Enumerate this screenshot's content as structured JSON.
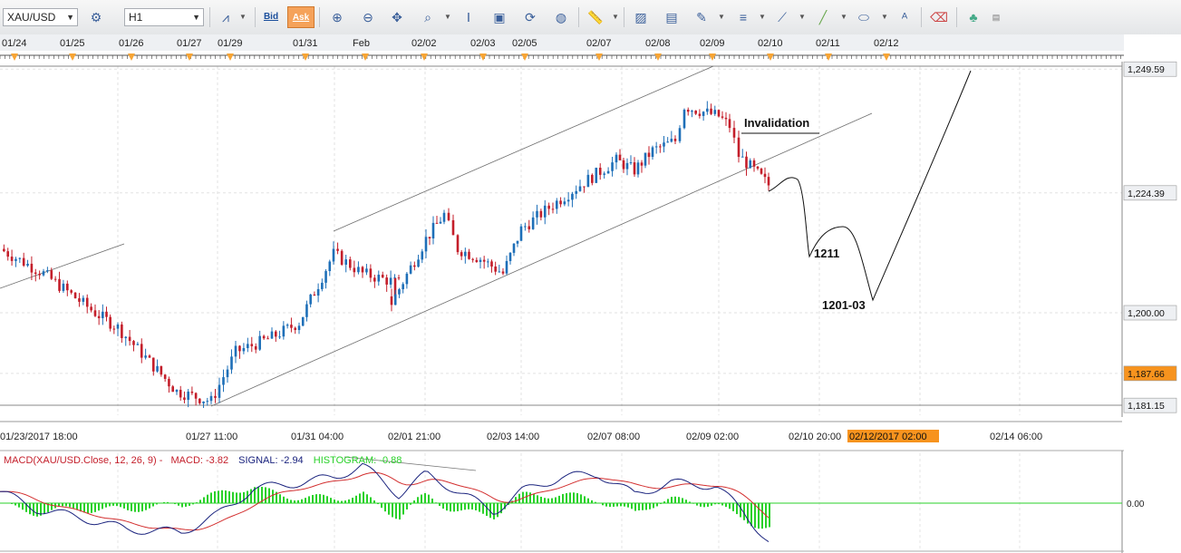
{
  "toolbar": {
    "symbol": "XAU/USD",
    "timeframe": "H1",
    "bid_label": "Bid",
    "ask_label": "Ask",
    "icons": [
      "line-chart-icon",
      "bid-icon",
      "ask-icon",
      "zoom-in-icon",
      "zoom-out-icon",
      "crosshair-icon",
      "indicator-icon",
      "grid-icon",
      "template-icon",
      "refresh-icon",
      "globe-icon",
      "ruler-icon",
      "image-icon",
      "screenshot-icon",
      "pencil-tools-icon",
      "lines-icon",
      "trend-line-icon",
      "draw-line-icon",
      "ellipse-icon",
      "text-icon",
      "eraser-icon",
      "objects-icon"
    ]
  },
  "top_dates": [
    "01/24",
    "01/25",
    "01/26",
    "01/27",
    "01/29",
    "01/31",
    "Feb",
    "02/02",
    "02/03",
    "02/05",
    "02/07",
    "02/08",
    "02/09",
    "02/10",
    "02/11",
    "02/12"
  ],
  "bottom_dates": [
    "01/23/2017 18:00",
    "01/27 11:00",
    "01/31 04:00",
    "02/01 21:00",
    "02/03 14:00",
    "02/07 08:00",
    "02/09 02:00",
    "02/10 20:00",
    "02/12/2017 02:00",
    "02/14 06:00"
  ],
  "highlighted_date": "02/12/2017 02:00",
  "price_labels": [
    "1,249.59",
    "1,224.39",
    "1,200.00",
    "1,187.66",
    "1,181.15"
  ],
  "current_price": "1,187.66",
  "annotations": {
    "invalidation": "Invalidation",
    "target1": "1211",
    "target2": "1201-03"
  },
  "macd_legend": {
    "name": "MACD(XAU/USD.Close, 12, 26, 9) -",
    "macd": "MACD: -3.82",
    "signal": "SIGNAL: -2.94",
    "histogram": "HISTOGRAM: -0.88"
  },
  "macd_zero_label": "0.00",
  "colors": {
    "bull": "#1e6fb8",
    "bear": "#c41e2a",
    "macd_line": "#1a237e",
    "signal_line": "#d32f2f",
    "histogram": "#29d129",
    "highlight": "#f7931e"
  },
  "chart_data": {
    "type": "candlestick",
    "symbol": "XAU/USD",
    "timeframe": "H1",
    "ylim": [
      1181.15,
      1249.59
    ],
    "key_levels": [
      1249.59,
      1224.39,
      1200.0,
      1187.66,
      1181.15
    ],
    "price_path": [
      [
        "01/23 18:00",
        1213
      ],
      [
        "01/24 12:00",
        1208
      ],
      [
        "01/25 00:00",
        1200
      ],
      [
        "01/25 18:00",
        1197
      ],
      [
        "01/26 08:00",
        1190
      ],
      [
        "01/26 20:00",
        1184
      ],
      [
        "01/27 11:00",
        1182
      ],
      [
        "01/27 20:00",
        1192
      ],
      [
        "01/30 08:00",
        1195
      ],
      [
        "01/30 20:00",
        1198
      ],
      [
        "01/31 04:00",
        1212
      ],
      [
        "01/31 16:00",
        1208
      ],
      [
        "02/01 08:00",
        1206
      ],
      [
        "02/01 21:00",
        1202
      ],
      [
        "02/02 04:00",
        1215
      ],
      [
        "02/02 12:00",
        1220
      ],
      [
        "02/02 20:00",
        1213
      ],
      [
        "02/03 08:00",
        1211
      ],
      [
        "02/03 14:00",
        1208
      ],
      [
        "02/03 20:00",
        1217
      ],
      [
        "02/06 08:00",
        1222
      ],
      [
        "02/06 20:00",
        1226
      ],
      [
        "02/07 08:00",
        1231
      ],
      [
        "02/07 16:00",
        1229
      ],
      [
        "02/08 04:00",
        1233
      ],
      [
        "02/08 12:00",
        1235
      ],
      [
        "02/08 20:00",
        1242
      ],
      [
        "02/09 02:00",
        1240
      ],
      [
        "02/09 10:00",
        1238
      ],
      [
        "02/09 14:00",
        1232
      ],
      [
        "02/09 20:00",
        1229
      ],
      [
        "02/10 00:00",
        1226
      ]
    ],
    "projection": [
      [
        "02/10 00:00",
        1226
      ],
      [
        "02/10 08:00",
        1228
      ],
      [
        "02/10 18:00",
        1211
      ],
      [
        "02/11 06:00",
        1214
      ],
      [
        "02/12 02:00",
        1202
      ],
      [
        "02/14 06:00",
        1249.59
      ]
    ],
    "macd": {
      "macd": -3.82,
      "signal": -2.94,
      "histogram": -0.88
    }
  }
}
